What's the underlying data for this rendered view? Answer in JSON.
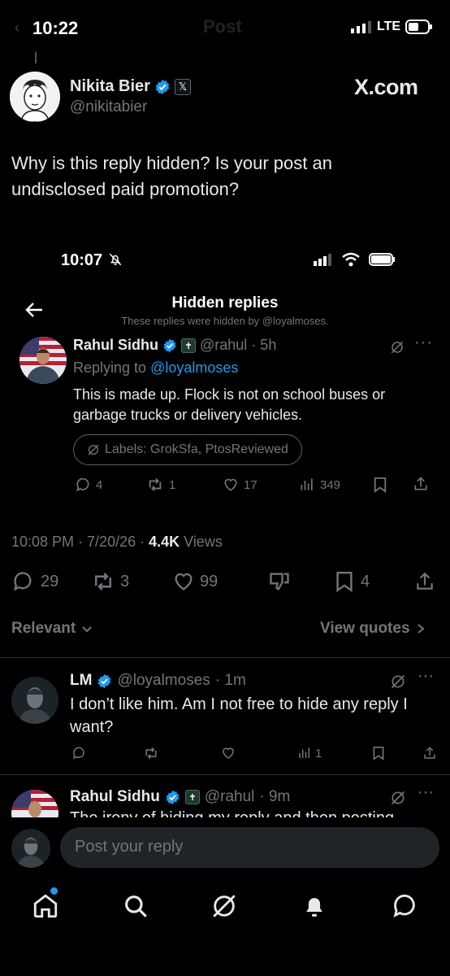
{
  "status_bar": {
    "time": "10:22",
    "network": "LTE"
  },
  "header_overlay": {
    "title": "Post"
  },
  "post": {
    "author_name": "Nikita Bier",
    "handle": "@nikitabier",
    "badge_glyph": "𝕏",
    "site_label": "X.com",
    "text_line1": "Why is this reply hidden? Is your post an",
    "text_line2": "undisclosed paid promotion?",
    "timestamp": "10:08 PM · 7/20/26 · ",
    "views_count": "4.4K",
    "views_label": " Views",
    "stats": {
      "replies": "29",
      "reposts": "3",
      "likes": "99",
      "bookmarks": "4"
    }
  },
  "screenshot": {
    "status_time": "10:07",
    "title": "Hidden replies",
    "subtitle": "These replies were hidden by @loyalmoses.",
    "reply": {
      "author": "Rahul Sidhu",
      "handle": "@rahul",
      "time": "· 5h",
      "replying_prefix": "Replying to ",
      "replying_to": "@loyalmoses",
      "text_line1": "This is made up. Flock is not on school buses or",
      "text_line2": "garbage trucks or delivery vehicles.",
      "labels": "Labels: GrokSfa, PtosReviewed",
      "stats": {
        "replies": "4",
        "reposts": "1",
        "likes": "17",
        "views": "349"
      }
    }
  },
  "sort": {
    "relevant": "Relevant",
    "view_quotes": "View quotes"
  },
  "replies": [
    {
      "author": "LM",
      "handle": "@loyalmoses",
      "time": "· 1m",
      "text_line1": "I don’t like him. Am I not free to hide any reply I",
      "text_line2": "want?",
      "views": "1"
    },
    {
      "author": "Rahul Sidhu",
      "handle": "@rahul",
      "time": "· 9m",
      "text_line1": "The irony of hiding my reply and then posting"
    }
  ],
  "composer": {
    "placeholder": "Post your reply"
  },
  "colors": {
    "accent": "#1d9bf0",
    "muted": "#71767b",
    "background": "#000000",
    "divider": "#2f3336"
  },
  "icons": [
    "back-arrow-icon",
    "verified-icon",
    "reply-icon",
    "repost-icon",
    "like-icon",
    "views-icon",
    "bookmark-icon",
    "share-icon",
    "grok-icon",
    "more-icon",
    "downvote-icon",
    "home-icon",
    "search-icon",
    "bell-icon",
    "messages-icon"
  ]
}
